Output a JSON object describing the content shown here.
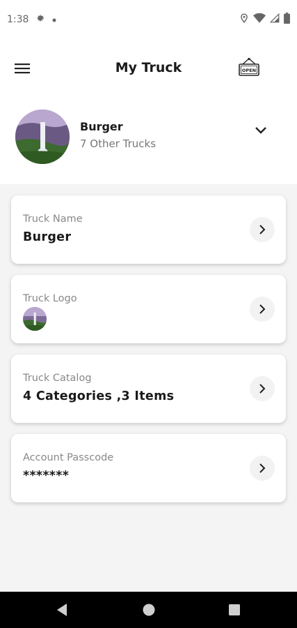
{
  "status_bar": {
    "time": "1:38",
    "icons": [
      "settings-icon",
      "dot-icon",
      "location-icon",
      "wifi-icon",
      "signal-icon",
      "battery-icon"
    ]
  },
  "app_bar": {
    "title": "My Truck",
    "menu_icon": "hamburger-menu-icon",
    "open_sign_text": "OPEN"
  },
  "truck_header": {
    "name": "Burger",
    "subtitle": "7 Other Trucks"
  },
  "cards": [
    {
      "label": "Truck Name",
      "value": "Burger"
    },
    {
      "label": "Truck Logo",
      "value": ""
    },
    {
      "label": "Truck Catalog",
      "value": "4 Categories ,3 Items"
    },
    {
      "label": "Account Passcode",
      "value": "*******"
    }
  ],
  "colors": {
    "background": "#f4f4f4",
    "card": "#ffffff",
    "nav_bar": "#000000",
    "text_primary": "#1a1a1a",
    "text_secondary": "#888888"
  }
}
